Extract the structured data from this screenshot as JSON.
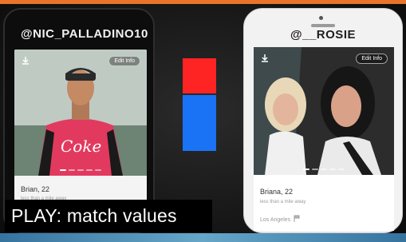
{
  "caption": "PLAY: match values",
  "profiles": [
    {
      "username": "@NIC_PALLADINO10",
      "edit_label": "Edit Info",
      "name_age": "Brian, 22",
      "subtitle": "less than a mile away",
      "shirt_text": "Coke"
    },
    {
      "username": "@__ROSIE",
      "edit_label": "Edit Info",
      "name_age": "Briana, 22",
      "subtitle": "less than a mile away",
      "location": "Los Angeles"
    }
  ],
  "colors": {
    "accent_top": "#e8742a",
    "swatch_top": "#ff2424",
    "swatch_bottom": "#1a72f5"
  },
  "icons": [
    "download-icon",
    "location-pin-icon"
  ]
}
